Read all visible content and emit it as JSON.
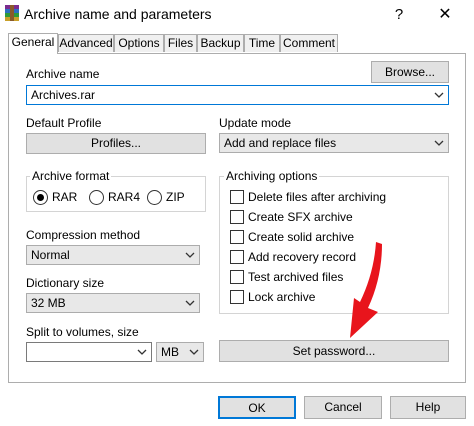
{
  "window": {
    "title": "Archive name and parameters",
    "help_label": "?",
    "close_label": "✕"
  },
  "tabs": [
    {
      "label": "General",
      "active": true
    },
    {
      "label": "Advanced",
      "active": false
    },
    {
      "label": "Options",
      "active": false
    },
    {
      "label": "Files",
      "active": false
    },
    {
      "label": "Backup",
      "active": false
    },
    {
      "label": "Time",
      "active": false
    },
    {
      "label": "Comment",
      "active": false
    }
  ],
  "archive_name": {
    "label": "Archive name",
    "value": "Archives.rar",
    "browse_label": "Browse..."
  },
  "default_profile": {
    "label": "Default Profile",
    "button_label": "Profiles..."
  },
  "update_mode": {
    "label": "Update mode",
    "value": "Add and replace files"
  },
  "archive_format": {
    "label": "Archive format",
    "options": [
      {
        "label": "RAR",
        "selected": true
      },
      {
        "label": "RAR4",
        "selected": false
      },
      {
        "label": "ZIP",
        "selected": false
      }
    ]
  },
  "compression": {
    "label": "Compression method",
    "value": "Normal"
  },
  "dictionary": {
    "label": "Dictionary size",
    "value": "32 MB"
  },
  "split": {
    "label": "Split to volumes, size",
    "value": "",
    "unit": "MB"
  },
  "archiving_options": {
    "label": "Archiving options",
    "items": [
      {
        "label": "Delete files after archiving",
        "checked": false
      },
      {
        "label": "Create SFX archive",
        "checked": false
      },
      {
        "label": "Create solid archive",
        "checked": false
      },
      {
        "label": "Add recovery record",
        "checked": false
      },
      {
        "label": "Test archived files",
        "checked": false
      },
      {
        "label": "Lock archive",
        "checked": false
      }
    ]
  },
  "set_password_label": "Set password...",
  "footer": {
    "ok_label": "OK",
    "cancel_label": "Cancel",
    "help_label": "Help"
  },
  "colors": {
    "annotation_arrow": "#e8141c",
    "focus_border": "#0078d7"
  }
}
